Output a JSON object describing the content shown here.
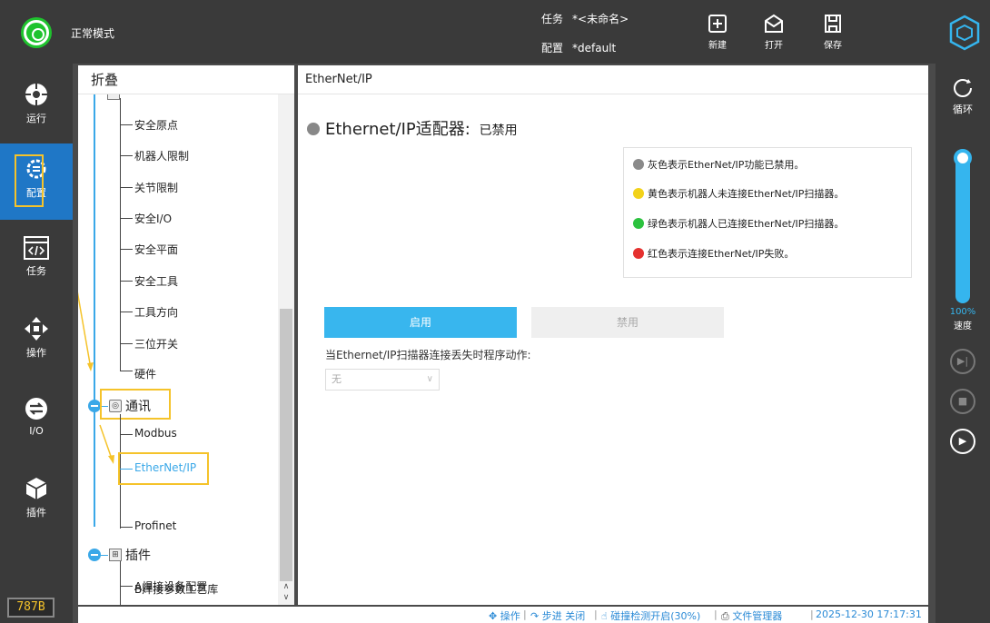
{
  "topbar": {
    "mode_label": "正常模式",
    "task_key": "任务",
    "task_value": "*<未命名>",
    "config_key": "配置",
    "config_value": "*default",
    "new_label": "新建",
    "open_label": "打开",
    "save_label": "保存"
  },
  "leftnav": {
    "items": [
      {
        "label": "运行",
        "icon": "run-icon"
      },
      {
        "label": "配置",
        "icon": "settings-gear-icon"
      },
      {
        "label": "任务",
        "icon": "code-icon"
      },
      {
        "label": "操作",
        "icon": "move-arrows-icon"
      },
      {
        "label": "I/O",
        "icon": "io-icon"
      },
      {
        "label": "插件",
        "icon": "cube-icon"
      }
    ],
    "version": "787B"
  },
  "tree": {
    "header": "折叠",
    "items": [
      "安全原点",
      "机器人限制",
      "关节限制",
      "安全I/O",
      "安全平面",
      "安全工具",
      "工具方向",
      "三位开关",
      "硬件"
    ],
    "cat_comm": "通讯",
    "comm_items": [
      "Modbus",
      "EtherNet/IP",
      "Profinet"
    ],
    "cat_plugin": "插件",
    "plugin_items": [
      "A焊接设备配置",
      "B焊接参数工艺库"
    ]
  },
  "content": {
    "header": "EtherNet/IP",
    "adapter_title": "Ethernet/IP适配器:",
    "adapter_status": "已禁用",
    "legend": [
      {
        "text": "灰色表示EtherNet/IP功能已禁用。",
        "color": "#8a8a8a"
      },
      {
        "text": "黄色表示机器人未连接EtherNet/IP扫描器。",
        "color": "#f2d21a"
      },
      {
        "text": "绿色表示机器人已连接EtherNet/IP扫描器。",
        "color": "#2cc23f"
      },
      {
        "text": "红色表示连接EtherNet/IP失败。",
        "color": "#e5312f"
      }
    ],
    "enable_label": "启用",
    "disable_label": "禁用",
    "lost_label": "当Ethernet/IP扫描器连接丢失时程序动作:",
    "lost_value": "无"
  },
  "statusbar": {
    "operate": "操作",
    "step": "步进 关闭",
    "collision": "碰撞检测开启(30%)",
    "file_manager": "文件管理器",
    "datetime": "2025-12-30 17:17:31"
  },
  "rightbar": {
    "loop_label": "循环",
    "speed_pct": "100%",
    "speed_label": "速度",
    "speed_value": 1.0
  },
  "colors": {
    "accent": "#38b6ee",
    "active_nav": "#1f77c6",
    "highlight": "#f5c32a",
    "mode_green": "#1fc32e"
  }
}
